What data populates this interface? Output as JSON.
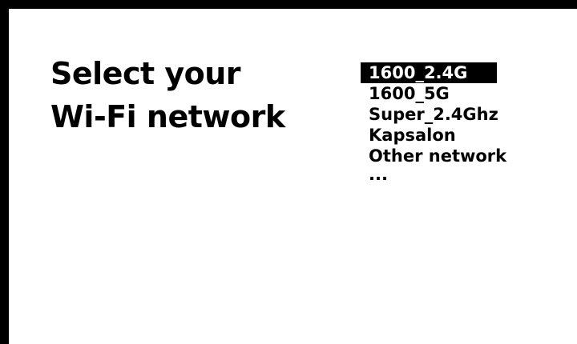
{
  "heading": {
    "line1": "Select your",
    "line2": "Wi-Fi network"
  },
  "networks": [
    {
      "label": "1600_2.4G",
      "selected": true
    },
    {
      "label": "1600_5G",
      "selected": false
    },
    {
      "label": "Super_2.4Ghz",
      "selected": false
    },
    {
      "label": "Kapsalon",
      "selected": false
    },
    {
      "label": "Other network",
      "selected": false
    }
  ],
  "more_indicator": "...",
  "colors": {
    "background": "#ffffff",
    "frame": "#000000",
    "text": "#000000",
    "selection": "#000000",
    "selection_text": "#ffffff"
  }
}
